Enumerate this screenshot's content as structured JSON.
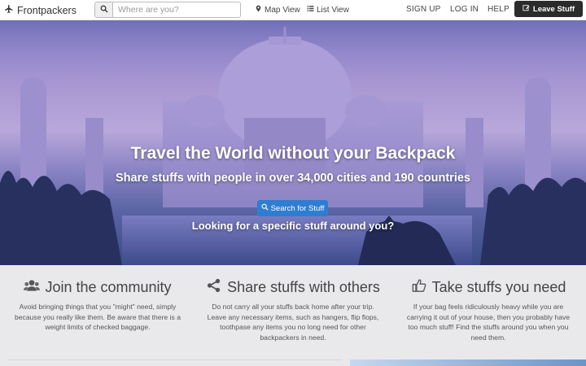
{
  "brand": {
    "name": "Frontpackers",
    "icon": "plane-icon"
  },
  "search": {
    "placeholder": "Where are you?",
    "icon": "search-icon"
  },
  "nav": {
    "map_view": "Map View",
    "list_view": "List View",
    "sign_up": "SIGN UP",
    "log_in": "LOG IN",
    "help": "HELP",
    "leave_stuff": "Leave Stuff"
  },
  "hero": {
    "title": "Travel the World without your Backpack",
    "subtitle": "Share stuffs with people in over 34,000 cities and 190 countries",
    "cta": "Search for Stuff",
    "question": "Looking for a specific stuff around you?"
  },
  "features": [
    {
      "title": "Join the community",
      "icon": "users-icon",
      "body": "Avoid bringing things that you \"might\" need, simply because you really like them. Be aware that there is a weight limits of checked baggage."
    },
    {
      "title": "Share stuffs with others",
      "icon": "share-icon",
      "body": "Do not carry all your stuffs back home after your trip. Leave any necessary items, such as hangers, flip flops, toothpase any items you no long need for other backpackers in need."
    },
    {
      "title": "Take stuffs you need",
      "icon": "thumbs-up-icon",
      "body": "If your bag feels ridiculously heavy while you are carrying it out of your house, then you probably have too much stuff! Find the stuffs around you when you need them."
    }
  ],
  "colors": {
    "cta": "#2f7dd1",
    "leave_button": "#2b2b2b",
    "features_bg": "#e9e9ec"
  }
}
